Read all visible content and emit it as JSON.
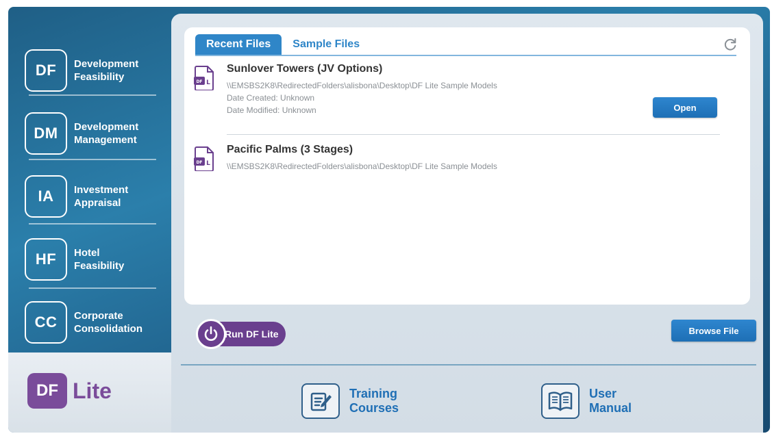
{
  "sidebar": {
    "items": [
      {
        "badge": "DF",
        "label_line1": "Development",
        "label_line2": "Feasibility"
      },
      {
        "badge": "DM",
        "label_line1": "Development",
        "label_line2": "Management"
      },
      {
        "badge": "IA",
        "label_line1": "Investment",
        "label_line2": "Appraisal"
      },
      {
        "badge": "HF",
        "label_line1": "Hotel",
        "label_line2": "Feasibility"
      },
      {
        "badge": "CC",
        "label_line1": "Corporate",
        "label_line2": "Consolidation"
      }
    ],
    "lite": {
      "badge": "DF",
      "label": "Lite"
    }
  },
  "tabs": [
    {
      "label": "Recent Files",
      "active": true
    },
    {
      "label": "Sample Files",
      "active": false
    }
  ],
  "files": [
    {
      "name": "Sunlover Towers (JV Options)",
      "path": "\\\\EMSBS2K8\\RedirectedFolders\\alisbona\\Desktop\\DF Lite Sample Models",
      "date_created": "Date Created: Unknown",
      "date_modified": "Date Modified: Unknown",
      "open_label": "Open"
    },
    {
      "name": "Pacific Palms (3 Stages)",
      "path": "\\\\EMSBS2K8\\RedirectedFolders\\alisbona\\Desktop\\DF Lite Sample Models"
    }
  ],
  "file_icon_text": "DF L",
  "browse_label": "Browse File",
  "run_label": "Run DF Lite",
  "links": {
    "training": {
      "line1": "Training",
      "line2": "Courses"
    },
    "manual": {
      "line1": "User",
      "line2": "Manual"
    }
  },
  "colors": {
    "accent": "#2f86c8",
    "purple": "#6a3f8e",
    "sidebar": "#2b7fab"
  }
}
